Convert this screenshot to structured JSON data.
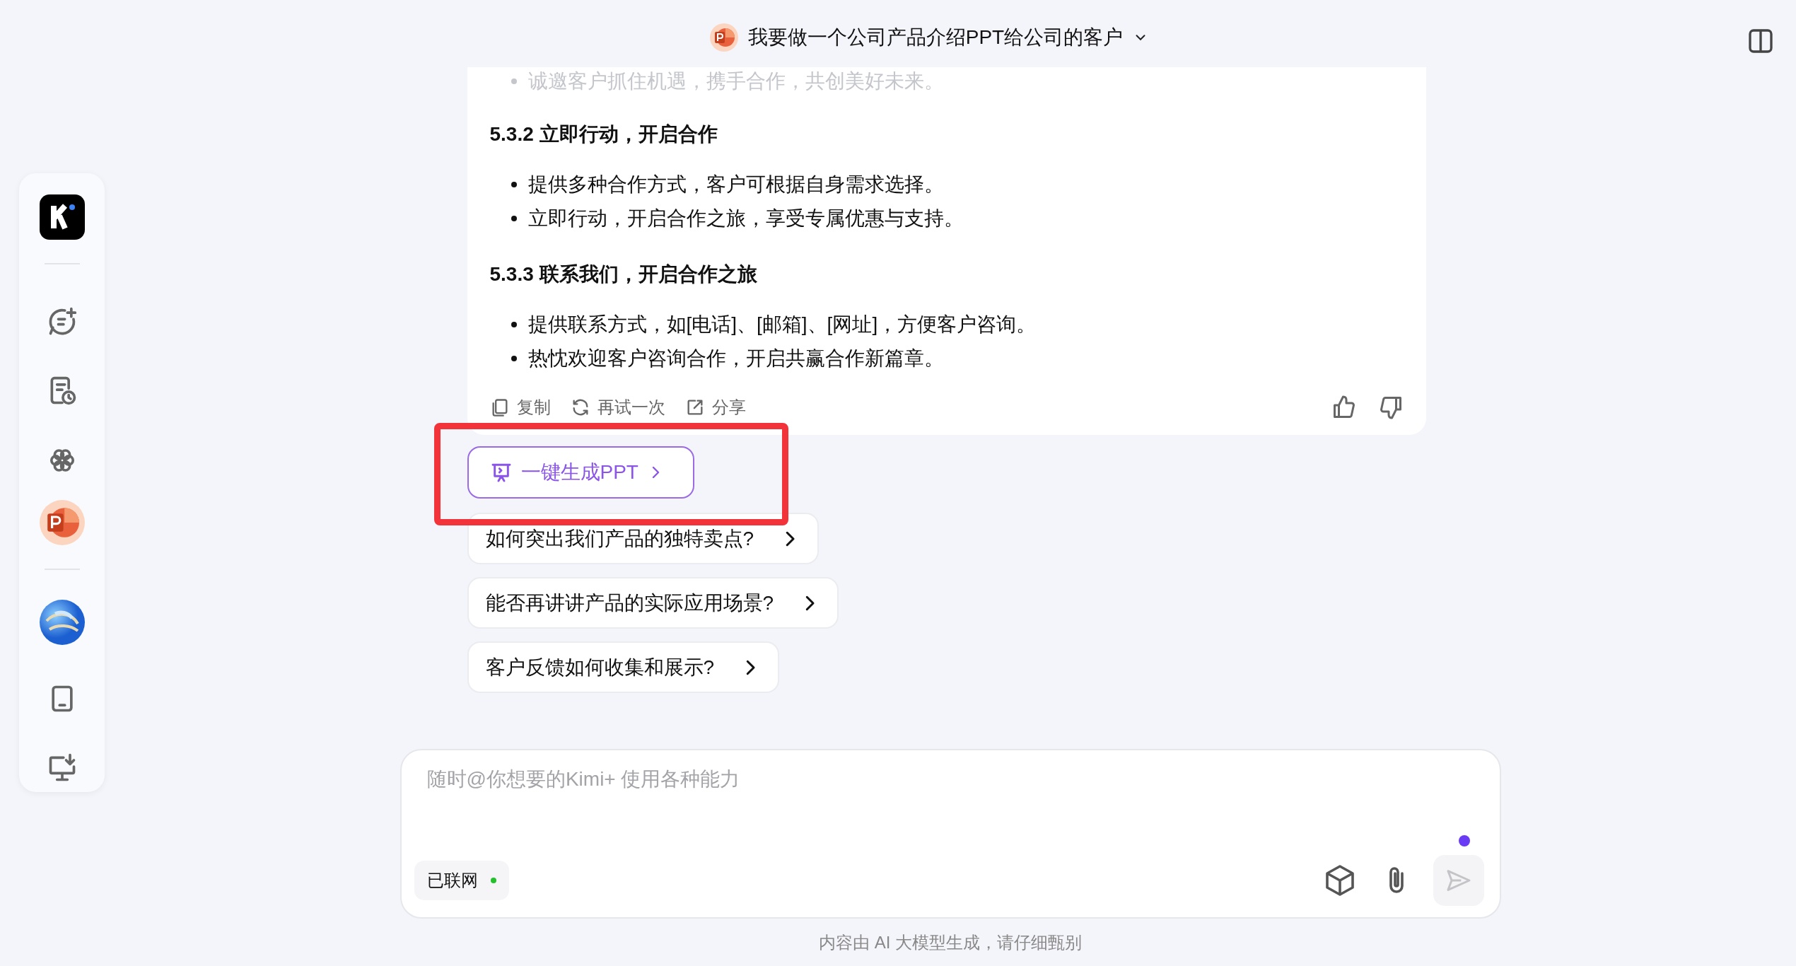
{
  "header": {
    "title": "我要做一个公司产品介绍PPT给公司的客户"
  },
  "message": {
    "clipped_line": "诚邀客户抓住机遇，携手合作，共创美好未来。",
    "sections": [
      {
        "heading": "5.3.2 立即行动，开启合作",
        "bullets": [
          "提供多种合作方式，客户可根据自身需求选择。",
          "立即行动，开启合作之旅，享受专属优惠与支持。"
        ]
      },
      {
        "heading": "5.3.3 联系我们，开启合作之旅",
        "bullets": [
          "提供联系方式，如[电话]、[邮箱]、[网址]，方便客户咨询。",
          "热忱欢迎客户咨询合作，开启共赢合作新篇章。"
        ]
      }
    ],
    "actions": [
      {
        "kind": "copy",
        "label": "复制"
      },
      {
        "kind": "retry",
        "label": "再试一次"
      },
      {
        "kind": "share",
        "label": "分享"
      }
    ]
  },
  "ppt_button": {
    "label": "一键生成PPT",
    "highlighted": true
  },
  "suggestions": [
    "如何突出我们产品的独特卖点?",
    "能否再讲讲产品的实际应用场景?",
    "客户反馈如何收集和展示?"
  ],
  "input": {
    "placeholder": "随时@你想要的Kimi+ 使用各种能力",
    "network": {
      "label": "已联网",
      "color": "#22c02a"
    },
    "send_disabled": true
  },
  "footer": "内容由 AI 大模型生成，请仔细甄别"
}
